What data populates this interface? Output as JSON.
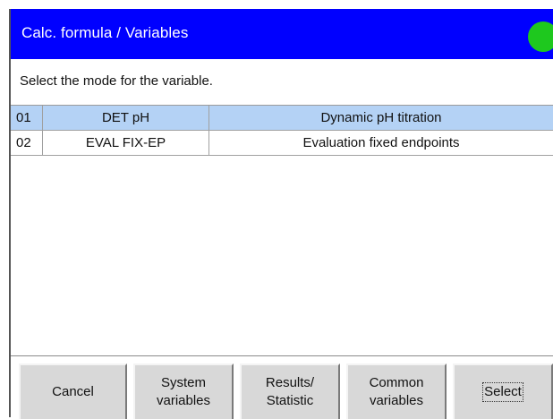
{
  "window": {
    "title": "Calc. formula / Variables",
    "status_color": "#1ec81e",
    "titlebar_color": "#0000ff"
  },
  "instruction": "Select the mode for the variable.",
  "table": {
    "rows": [
      {
        "num": "01",
        "name": "DET pH",
        "description": "Dynamic pH titration",
        "selected": true
      },
      {
        "num": "02",
        "name": "EVAL FIX-EP",
        "description": "Evaluation fixed endpoints",
        "selected": false
      }
    ],
    "selected_color": "#b4d2f5"
  },
  "toolbar": {
    "cancel": "Cancel",
    "system_variables": "System\nvariables",
    "results_statistic": "Results/\nStatistic",
    "common_variables": "Common\nvariables",
    "select": "Select"
  }
}
